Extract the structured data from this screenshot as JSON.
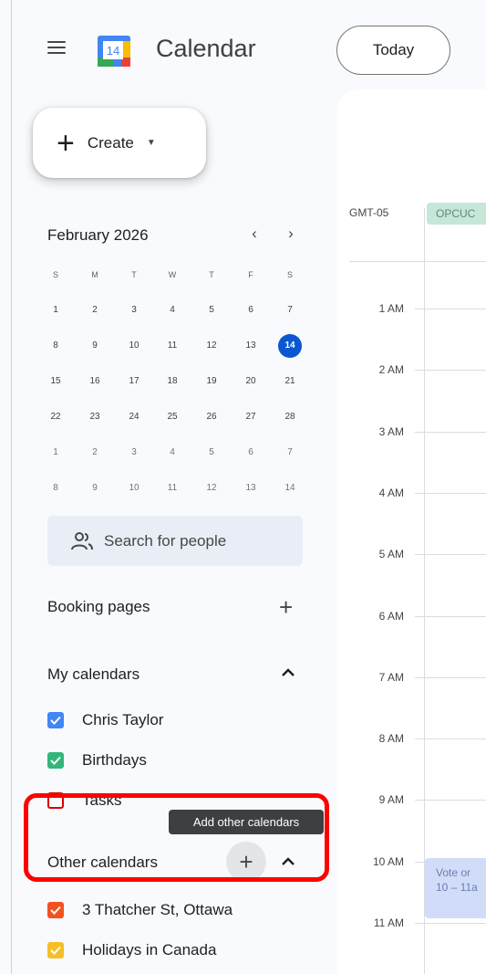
{
  "header": {
    "app_title": "Calendar",
    "logo_day": "14",
    "today_label": "Today"
  },
  "create": {
    "label": "Create"
  },
  "mini_calendar": {
    "month_label": "February 2026",
    "weekdays": [
      "S",
      "M",
      "T",
      "W",
      "T",
      "F",
      "S"
    ],
    "weeks": [
      [
        "1",
        "2",
        "3",
        "4",
        "5",
        "6",
        "7"
      ],
      [
        "8",
        "9",
        "10",
        "11",
        "12",
        "13",
        "14"
      ],
      [
        "15",
        "16",
        "17",
        "18",
        "19",
        "20",
        "21"
      ],
      [
        "22",
        "23",
        "24",
        "25",
        "26",
        "27",
        "28"
      ],
      [
        "1",
        "2",
        "3",
        "4",
        "5",
        "6",
        "7"
      ],
      [
        "8",
        "9",
        "10",
        "11",
        "12",
        "13",
        "14"
      ]
    ],
    "today": "14"
  },
  "search": {
    "placeholder": "Search for people"
  },
  "booking": {
    "label": "Booking pages"
  },
  "my_calendars": {
    "label": "My calendars",
    "items": [
      {
        "label": "Chris Taylor",
        "color": "#4285f4",
        "checked": true
      },
      {
        "label": "Birthdays",
        "color": "#33b679",
        "checked": true
      },
      {
        "label": "Tasks",
        "color": "#d50000",
        "checked": false
      }
    ]
  },
  "tooltip": {
    "text": "Add other calendars"
  },
  "other_calendars": {
    "label": "Other calendars",
    "items": [
      {
        "label": "3 Thatcher St, Ottawa",
        "color": "#f4511e",
        "checked": true
      },
      {
        "label": "Holidays in Canada",
        "color": "#f6bf26",
        "checked": true
      }
    ]
  },
  "day_view": {
    "timezone": "GMT-05",
    "allday_event": "OPCUC",
    "hours": [
      "1 AM",
      "2 AM",
      "3 AM",
      "4 AM",
      "5 AM",
      "6 AM",
      "7 AM",
      "8 AM",
      "9 AM",
      "10 AM",
      "11 AM"
    ],
    "event": {
      "title": "Vote or",
      "time": "10 – 11a"
    }
  }
}
